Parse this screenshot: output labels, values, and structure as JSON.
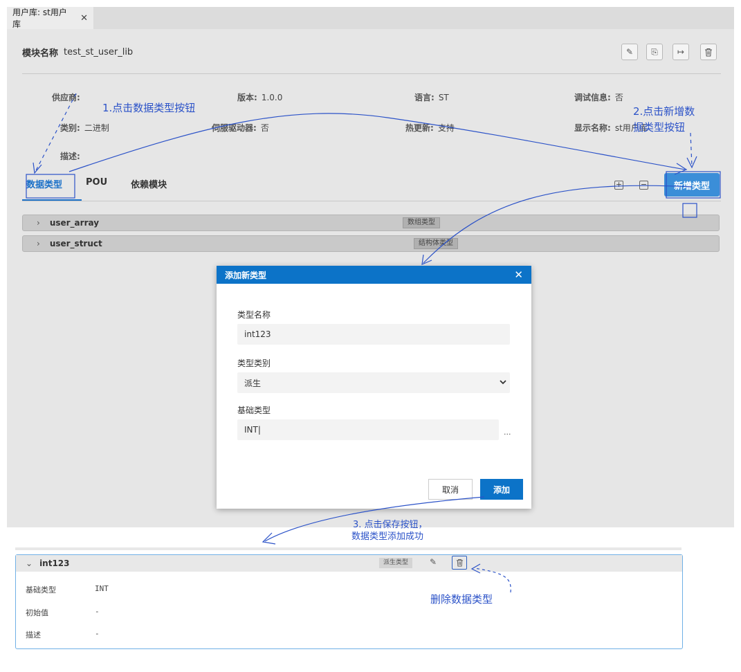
{
  "tab": {
    "title": "用户库: st用户库",
    "close": "✕"
  },
  "module": {
    "label": "模块名称",
    "name": "test_st_user_lib"
  },
  "toolbar": {
    "edit": "✎",
    "export": "⎘",
    "exit": "↦",
    "delete": "🗑"
  },
  "info": {
    "vendor_label": "供应商:",
    "vendor_value": "",
    "version_label": "版本:",
    "version_value": "1.0.0",
    "lang_label": "语言:",
    "lang_value": "ST",
    "debug_label": "调试信息:",
    "debug_value": "否",
    "category_label": "类别:",
    "category_value": "二进制",
    "servo_label": "伺服驱动器:",
    "servo_value": "否",
    "hotupdate_label": "热更新:",
    "hotupdate_value": "支持",
    "display_label": "显示名称:",
    "display_value": "st用户库",
    "desc_label": "描述:",
    "desc_value": ""
  },
  "tabs2": {
    "datatype": "数据类型",
    "pou": "POU",
    "deps": "依赖模块"
  },
  "icons": {
    "expand_all": "+",
    "collapse_all": "−"
  },
  "add_type_button": "新增类型",
  "rows": [
    {
      "name": "user_array",
      "badge": "数组类型"
    },
    {
      "name": "user_struct",
      "badge": "结构体类型"
    }
  ],
  "dialog": {
    "title": "添加新类型",
    "close": "✕",
    "name_label": "类型名称",
    "name_value": "int123",
    "category_label": "类型类别",
    "category_value": "派生",
    "base_label": "基础类型",
    "base_value": "INT",
    "more": "...",
    "cancel": "取消",
    "add": "添加"
  },
  "detail": {
    "name": "int123",
    "badge": "派生类型",
    "base_label": "基础类型",
    "base_value": "INT",
    "init_label": "初始值",
    "init_value": "-",
    "desc_label": "描述",
    "desc_value": "-"
  },
  "annotations": {
    "step1": "1.点击数据类型按钮",
    "step2_line1": "2.点击新增数",
    "step2_line2": "据类型按钮",
    "step3_line1": "3. 点击保存按钮，",
    "step3_line2": "数据类型添加成功",
    "delete_note": "删除数据类型"
  },
  "colors": {
    "accent": "#0c73c8",
    "annotation": "#2b52c8",
    "button": "#3b8ed8"
  }
}
